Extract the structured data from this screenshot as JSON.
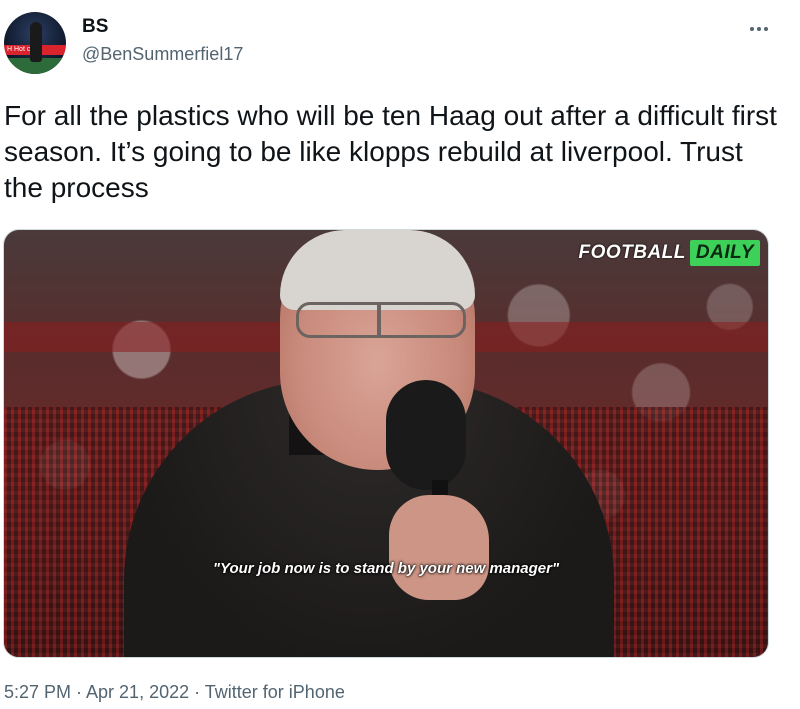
{
  "author": {
    "name": "BS",
    "handle": "@BenSummerfiel17",
    "avatar_icon": "avatar-image",
    "avatar_board_text": "H Hot   com"
  },
  "tweet": {
    "text": "For all the plastics who will be ten Haag out after a difficult first season. It’s going to be like klopps rebuild at liverpool. Trust the process"
  },
  "media": {
    "logo_part1": "FOOTBALL",
    "logo_part2": "DAILY",
    "caption": "\"Your job now is to stand by your new manager\"",
    "logo_color": "#3dd15a"
  },
  "footer": {
    "timestamp": "5:27 PM · Apr 21, 2022 · Twitter for iPhone"
  },
  "colors": {
    "text": "#0f1419",
    "secondary": "#536471"
  },
  "icons": {
    "more": "more-horizontal-icon"
  }
}
